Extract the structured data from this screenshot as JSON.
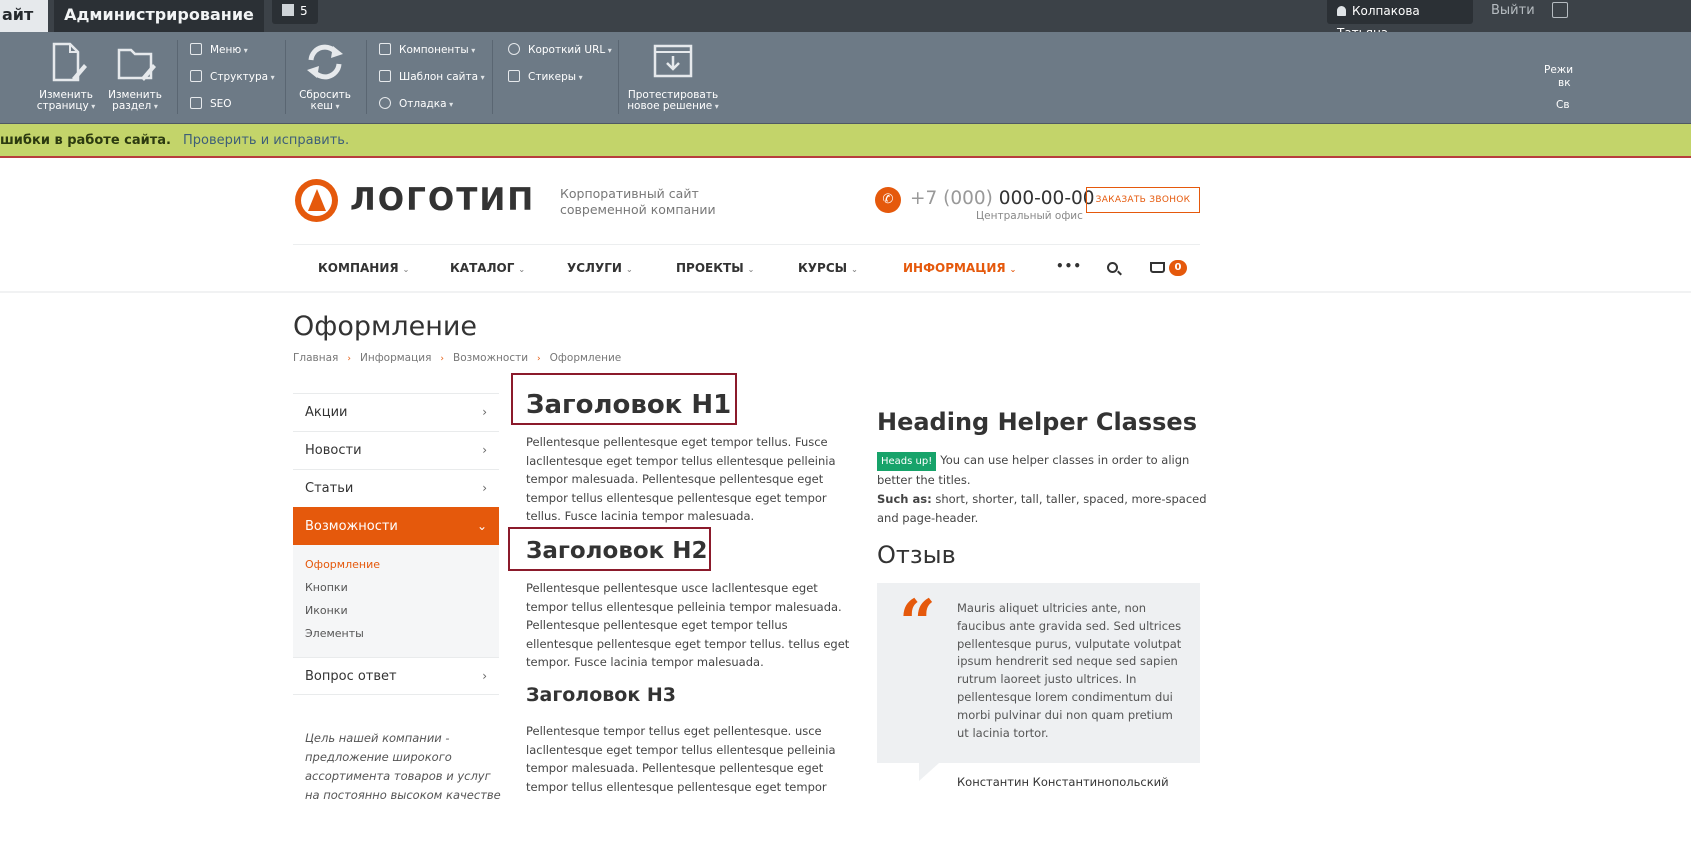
{
  "admin": {
    "tab_site": "айт",
    "tab_admin": "Администрирование",
    "notifications": "5",
    "user": "Колпакова Татьяна",
    "logout": "Выйти"
  },
  "toolbar": {
    "edit_page": [
      "Изменить",
      "страницу"
    ],
    "edit_section": [
      "Изменить",
      "раздел"
    ],
    "menu": "Меню",
    "structure": "Структура",
    "seo": "SEO",
    "clear_cache": [
      "Сбросить",
      "кеш"
    ],
    "components": "Компоненты",
    "site_template": "Шаблон сайта",
    "debug": "Отладка",
    "short_url": "Короткий URL",
    "stickers": "Стикеры",
    "test_solution": [
      "Протестировать",
      "новое решение"
    ],
    "right_labels": [
      "Режи",
      "вк",
      "Св"
    ]
  },
  "warning": {
    "text": "шибки в работе сайта.",
    "link": "Проверить и исправить."
  },
  "header": {
    "logo": "ЛОГОТИП",
    "slogan": [
      "Корпоративный сайт",
      "современной компании"
    ],
    "phone_prefix": "+7 (000)",
    "phone_number": "000-00-00",
    "office": "Центральный офис",
    "callback": "ЗАКАЗАТЬ ЗВОНОК"
  },
  "nav": {
    "items": [
      "КОМПАНИЯ",
      "КАТАЛОГ",
      "УСЛУГИ",
      "ПРОЕКТЫ",
      "КУРСЫ",
      "ИНФОРМАЦИЯ"
    ],
    "more": "•••",
    "cart_count": "0"
  },
  "page": {
    "title": "Оформление",
    "breadcrumb": [
      "Главная",
      "Информация",
      "Возможности",
      "Оформление"
    ]
  },
  "sidebar": {
    "items": [
      "Акции",
      "Новости",
      "Статьи",
      "Возможности"
    ],
    "sub": [
      "Оформление",
      "Кнопки",
      "Иконки",
      "Элементы"
    ],
    "last": "Вопрос ответ",
    "quote": "Цель нашей компании - предложение широкого ассортимента товаров и услуг на постоянно высоком качестве"
  },
  "content": {
    "h1": "Заголовок H1",
    "p1": "Pellentesque pellentesque eget tempor tellus. Fusce lacllentesque eget tempor tellus ellentesque pelleinia tempor malesuada. Pellentesque pellentesque eget tempor tellus ellentesque pellentesque eget tempor tellus. Fusce lacinia tempor malesuada.",
    "h2": "Заголовок H2",
    "p2": "Pellentesque pellentesque usce lacllentesque eget tempor tellus ellentesque pelleinia tempor malesuada. Pellentesque pellentesque eget tempor tellus ellentesque pellentesque eget tempor tellus. tellus eget tempor. Fusce lacinia tempor malesuada.",
    "h3": "Заголовок H3",
    "p3": "Pellentesque tempor tellus eget pellentesque. usce lacllentesque eget tempor tellus ellentesque pelleinia tempor malesuada. Pellentesque pellentesque eget tempor tellus ellentesque pellentesque eget tempor"
  },
  "right": {
    "helper_title": "Heading Helper Classes",
    "badge": "Heads up!",
    "helper_text": "You can use helper classes in order to align better the titles.",
    "such_as_label": "Such as:",
    "such_as": "short, shorter, tall, taller, spaced, more-spaced and page-header.",
    "review_title": "Отзыв",
    "quote_mark": "“",
    "review_text": "Mauris aliquet ultricies ante, non faucibus ante gravida sed. Sed ultrices pellentesque purus, vulputate volutpat ipsum hendrerit sed neque sed sapien rutrum laoreet justo ultrices. In pellentesque lorem condimentum dui morbi pulvinar dui non quam pretium ut lacinia tortor.",
    "review_author": "Константин Константинопольский"
  },
  "colors": {
    "accent": "#e5590c",
    "admin_bg": "#3c4248",
    "toolbar_bg": "#6d7a86",
    "warning_bg": "#c3d46a",
    "badge": "#17a36a",
    "highlight_box": "#8b1a2b"
  }
}
